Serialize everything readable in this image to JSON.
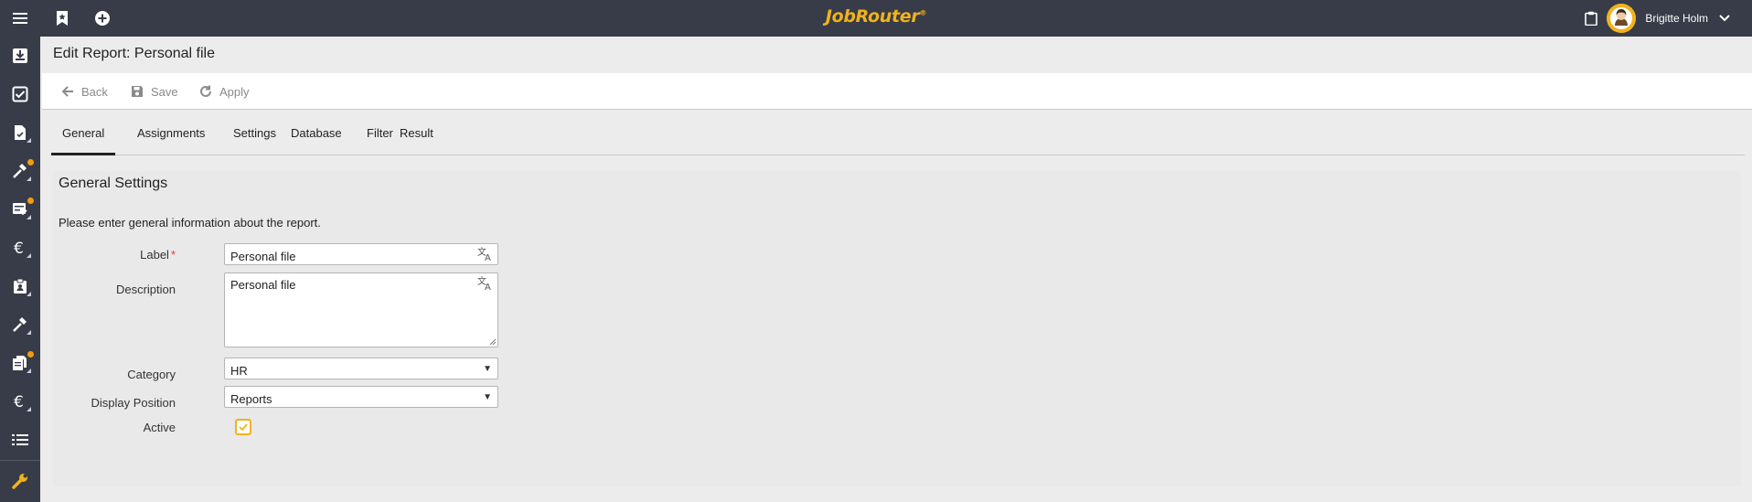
{
  "app": {
    "logo": "JobRouter",
    "logo_mark": "®",
    "brand_color": "#f2b21b",
    "topbar_color": "#373c48"
  },
  "topbar": {
    "menu_icon": "hamburger-icon",
    "bookmark_icon": "bookmark-star-icon",
    "add_icon": "plus-circle-icon",
    "clipboard_icon": "clipboard-icon",
    "user_name": "Brigitte Holm",
    "user_menu_icon": "chevron-down-icon"
  },
  "sidebar": {
    "items": [
      {
        "icon": "inbox-download-icon",
        "badge": false
      },
      {
        "icon": "checkbox-icon",
        "badge": false
      },
      {
        "icon": "document-icon",
        "badge": false
      },
      {
        "icon": "hammer-icon",
        "badge": true
      },
      {
        "icon": "table-check-icon",
        "badge": true
      },
      {
        "icon": "euro-icon",
        "badge": false
      },
      {
        "icon": "badge-icon",
        "badge": false
      },
      {
        "icon": "hammer-icon",
        "badge": false
      },
      {
        "icon": "copy-document-icon",
        "badge": true
      },
      {
        "icon": "euro-icon",
        "badge": false
      },
      {
        "icon": "list-icon",
        "badge": false
      },
      {
        "icon": "wrench-icon",
        "badge": false
      }
    ]
  },
  "page": {
    "title": "Edit Report: Personal file"
  },
  "toolbar": {
    "back_label": "Back",
    "save_label": "Save",
    "apply_label": "Apply"
  },
  "tabs": [
    {
      "label": "General",
      "active": true
    },
    {
      "label": "Assignments",
      "active": false
    },
    {
      "label": "Settings",
      "active": false
    },
    {
      "label": "Database",
      "active": false
    },
    {
      "label": "Filter",
      "active": false
    },
    {
      "label": "Result",
      "active": false
    }
  ],
  "general": {
    "section_title": "General Settings",
    "description": "Please enter general information about the report.",
    "label_field": {
      "label": "Label",
      "required_mark": "*",
      "value": "Personal file"
    },
    "description_field": {
      "label": "Description",
      "value": "Personal file"
    },
    "category_field": {
      "label": "Category",
      "value": "HR",
      "arrow": "▼"
    },
    "display_position_field": {
      "label": "Display Position",
      "value": "Reports",
      "arrow": "▼"
    },
    "active_field": {
      "label": "Active",
      "checked": true
    }
  }
}
